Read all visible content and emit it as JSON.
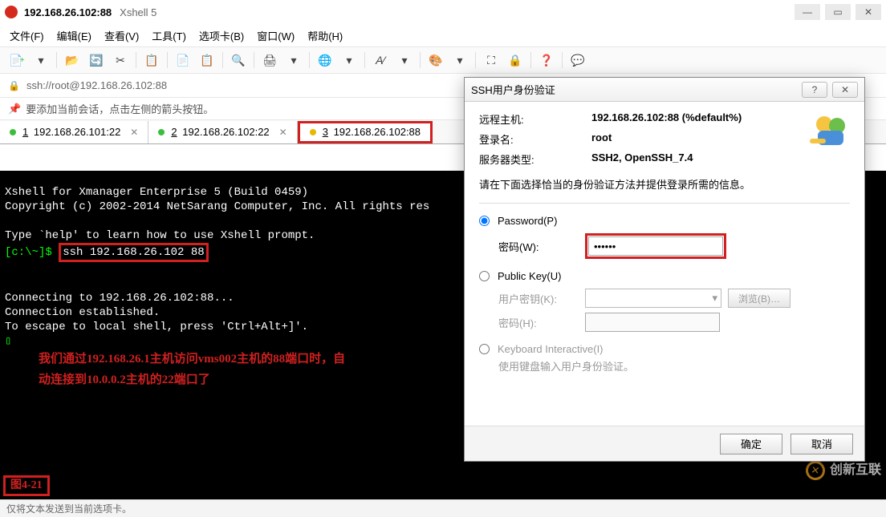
{
  "window": {
    "title": "192.168.26.102:88",
    "app_subtitle": "Xshell 5"
  },
  "menu": {
    "file": "文件(F)",
    "edit": "编辑(E)",
    "view": "查看(V)",
    "tools": "工具(T)",
    "tabs": "选项卡(B)",
    "windowm": "窗口(W)",
    "help": "帮助(H)"
  },
  "address": {
    "icon": "🔒",
    "url": "ssh://root@192.168.26.102:88"
  },
  "info_bar": {
    "icon": "📌",
    "text": "要添加当前会话，点击左侧的箭头按钮。"
  },
  "tabs": [
    {
      "num": "1",
      "label": "192.168.26.101:22",
      "state": "connected"
    },
    {
      "num": "2",
      "label": "192.168.26.102:22",
      "state": "connected"
    },
    {
      "num": "3",
      "label": "192.168.26.102:88",
      "state": "connecting"
    }
  ],
  "terminal": {
    "line1": "Xshell for Xmanager Enterprise 5 (Build 0459)",
    "line2": "Copyright (c) 2002-2014 NetSarang Computer, Inc. All rights res",
    "line4": "Type `help' to learn how to use Xshell prompt.",
    "prompt": "[c:\\~]$",
    "cmd": "ssh 192.168.26.102 88",
    "line6": "Connecting to 192.168.26.102:88...",
    "line7": "Connection established.",
    "line8": "To escape to local shell, press 'Ctrl+Alt+]'.",
    "cursor": "▯",
    "note1": "我们通过192.168.26.1主机访问vms002主机的88端口时，自",
    "note2": "动连接到10.0.0.2主机的22端口了",
    "fig": "图4-21"
  },
  "dialog": {
    "title": "SSH用户身份验证",
    "remote_host_label": "远程主机:",
    "remote_host_value": "192.168.26.102:88 (%default%)",
    "login_label": "登录名:",
    "login_value": "root",
    "server_type_label": "服务器类型:",
    "server_type_value": "SSH2, OpenSSH_7.4",
    "instruction": "请在下面选择恰当的身份验证方法并提供登录所需的信息。",
    "password_option": "Password(P)",
    "password_label": "密码(W):",
    "password_value": "●●●●●●",
    "publickey_option": "Public Key(U)",
    "user_cert_label": "用户密钥(K):",
    "browse_button": "浏览(B)…",
    "cert_pw_label": "密码(H):",
    "keyboard_option": "Keyboard Interactive(I)",
    "keyboard_note": "使用键盘输入用户身份验证。",
    "ok": "确定",
    "cancel": "取消"
  },
  "status_bar": {
    "text": "仅将文本发送到当前选项卡。"
  },
  "watermark": {
    "text": "创新互联"
  }
}
